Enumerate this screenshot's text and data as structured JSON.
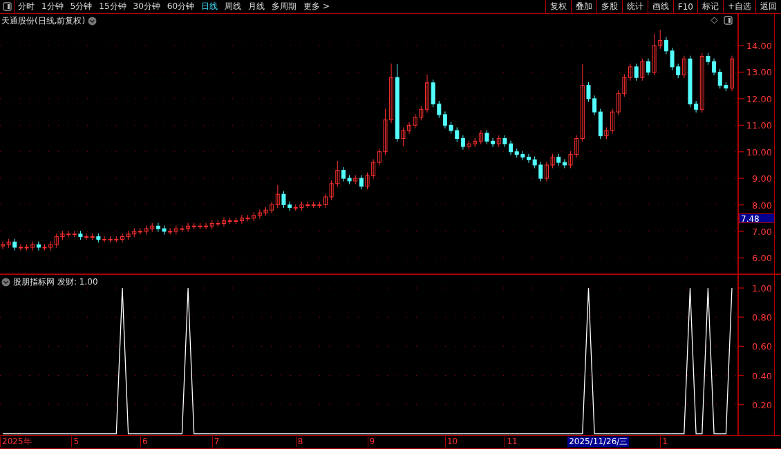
{
  "toolbar": {
    "periods": [
      {
        "label": "分时",
        "selected": false
      },
      {
        "label": "1分钟",
        "selected": false
      },
      {
        "label": "5分钟",
        "selected": false
      },
      {
        "label": "15分钟",
        "selected": false
      },
      {
        "label": "30分钟",
        "selected": false
      },
      {
        "label": "60分钟",
        "selected": false
      },
      {
        "label": "日线",
        "selected": true
      },
      {
        "label": "周线",
        "selected": false
      },
      {
        "label": "月线",
        "selected": false
      },
      {
        "label": "多周期",
        "selected": false
      },
      {
        "label": "更多 >",
        "selected": false
      }
    ],
    "buttons": [
      "复权",
      "叠加",
      "多股",
      "统计",
      "画线",
      "F10",
      "标记",
      "+自选",
      "返回"
    ]
  },
  "price_pane": {
    "title": "天通股份(日线,前复权)",
    "cursor_price": "7.48",
    "chart_data": {
      "type": "candlestick",
      "grid": true,
      "ohlc": [
        [
          6.45,
          6.62,
          6.33,
          6.5
        ],
        [
          6.5,
          6.72,
          6.38,
          6.6
        ],
        [
          6.6,
          6.72,
          6.28,
          6.4
        ],
        [
          6.4,
          6.52,
          6.28,
          6.4
        ],
        [
          6.4,
          6.52,
          6.28,
          6.4
        ],
        [
          6.4,
          6.62,
          6.28,
          6.5
        ],
        [
          6.5,
          6.62,
          6.28,
          6.4
        ],
        [
          6.4,
          6.52,
          6.28,
          6.4
        ],
        [
          6.4,
          6.62,
          6.28,
          6.5
        ],
        [
          6.5,
          6.92,
          6.38,
          6.8
        ],
        [
          6.8,
          7.02,
          6.68,
          6.9
        ],
        [
          6.9,
          7.02,
          6.78,
          6.9
        ],
        [
          6.9,
          7.02,
          6.78,
          6.9
        ],
        [
          6.9,
          7.02,
          6.68,
          6.8
        ],
        [
          6.8,
          6.92,
          6.68,
          6.8
        ],
        [
          6.8,
          6.92,
          6.68,
          6.8
        ],
        [
          6.8,
          6.92,
          6.58,
          6.7
        ],
        [
          6.7,
          6.82,
          6.58,
          6.7
        ],
        [
          6.7,
          6.82,
          6.58,
          6.7
        ],
        [
          6.7,
          6.82,
          6.58,
          6.7
        ],
        [
          6.7,
          6.92,
          6.58,
          6.8
        ],
        [
          6.8,
          7.02,
          6.68,
          6.9
        ],
        [
          6.9,
          7.12,
          6.78,
          7.0
        ],
        [
          7.0,
          7.12,
          6.88,
          7.0
        ],
        [
          7.0,
          7.22,
          6.88,
          7.1
        ],
        [
          7.1,
          7.32,
          6.98,
          7.2
        ],
        [
          7.2,
          7.32,
          6.98,
          7.1
        ],
        [
          7.1,
          7.22,
          6.88,
          7.0
        ],
        [
          7.0,
          7.12,
          6.88,
          7.0
        ],
        [
          7.0,
          7.22,
          6.88,
          7.1
        ],
        [
          7.1,
          7.22,
          6.98,
          7.1
        ],
        [
          7.1,
          7.32,
          6.98,
          7.2
        ],
        [
          7.2,
          7.32,
          7.08,
          7.2
        ],
        [
          7.2,
          7.32,
          7.08,
          7.2
        ],
        [
          7.2,
          7.32,
          7.08,
          7.2
        ],
        [
          7.2,
          7.42,
          7.08,
          7.3
        ],
        [
          7.3,
          7.42,
          7.18,
          7.3
        ],
        [
          7.3,
          7.52,
          7.18,
          7.4
        ],
        [
          7.4,
          7.52,
          7.28,
          7.4
        ],
        [
          7.4,
          7.52,
          7.28,
          7.4
        ],
        [
          7.4,
          7.62,
          7.28,
          7.5
        ],
        [
          7.5,
          7.62,
          7.38,
          7.5
        ],
        [
          7.5,
          7.72,
          7.38,
          7.6
        ],
        [
          7.6,
          7.82,
          7.48,
          7.7
        ],
        [
          7.7,
          7.92,
          7.58,
          7.8
        ],
        [
          7.8,
          8.12,
          7.68,
          8.0
        ],
        [
          8.0,
          8.75,
          7.88,
          8.4
        ],
        [
          8.4,
          8.52,
          7.88,
          8.0
        ],
        [
          8.0,
          8.12,
          7.78,
          7.9
        ],
        [
          7.9,
          8.02,
          7.78,
          7.9
        ],
        [
          7.9,
          8.12,
          7.78,
          8.0
        ],
        [
          8.0,
          8.12,
          7.88,
          8.0
        ],
        [
          8.0,
          8.12,
          7.88,
          8.0
        ],
        [
          8.0,
          8.12,
          7.88,
          8.0
        ],
        [
          8.0,
          8.42,
          7.88,
          8.3
        ],
        [
          8.3,
          8.92,
          8.18,
          8.8
        ],
        [
          8.8,
          9.65,
          8.68,
          9.3
        ],
        [
          9.3,
          9.42,
          8.88,
          9.0
        ],
        [
          9.0,
          9.12,
          8.78,
          8.9
        ],
        [
          8.9,
          9.12,
          8.78,
          9.0
        ],
        [
          9.0,
          9.12,
          8.58,
          8.7
        ],
        [
          8.7,
          9.22,
          8.58,
          9.1
        ],
        [
          9.1,
          9.72,
          8.98,
          9.6
        ],
        [
          9.6,
          10.12,
          9.48,
          10.0
        ],
        [
          10.0,
          11.62,
          9.88,
          11.2
        ],
        [
          11.2,
          13.32,
          11.08,
          12.8
        ],
        [
          12.8,
          13.3,
          10.38,
          10.5
        ],
        [
          10.5,
          10.92,
          10.2,
          10.8
        ],
        [
          10.8,
          11.12,
          10.68,
          11.0
        ],
        [
          11.0,
          11.42,
          10.88,
          11.3
        ],
        [
          11.3,
          11.72,
          11.18,
          11.6
        ],
        [
          11.6,
          12.92,
          11.48,
          12.6
        ],
        [
          12.6,
          12.72,
          11.68,
          11.8
        ],
        [
          11.8,
          11.92,
          11.28,
          11.4
        ],
        [
          11.4,
          11.52,
          10.88,
          11.0
        ],
        [
          11.0,
          11.12,
          10.68,
          10.8
        ],
        [
          10.8,
          10.92,
          10.38,
          10.5
        ],
        [
          10.5,
          10.62,
          10.08,
          10.2
        ],
        [
          10.2,
          10.42,
          10.08,
          10.3
        ],
        [
          10.3,
          10.52,
          10.18,
          10.4
        ],
        [
          10.4,
          10.82,
          10.28,
          10.7
        ],
        [
          10.7,
          10.82,
          10.28,
          10.4
        ],
        [
          10.4,
          10.52,
          10.18,
          10.3
        ],
        [
          10.3,
          10.62,
          10.18,
          10.5
        ],
        [
          10.5,
          10.62,
          10.18,
          10.3
        ],
        [
          10.3,
          10.42,
          9.88,
          10.0
        ],
        [
          10.0,
          10.12,
          9.78,
          9.9
        ],
        [
          9.9,
          10.02,
          9.68,
          9.8
        ],
        [
          9.8,
          9.92,
          9.58,
          9.7
        ],
        [
          9.7,
          9.82,
          9.38,
          9.5
        ],
        [
          9.5,
          9.62,
          8.88,
          9.0
        ],
        [
          9.0,
          9.62,
          8.88,
          9.5
        ],
        [
          9.5,
          9.92,
          9.38,
          9.8
        ],
        [
          9.8,
          9.92,
          9.48,
          9.6
        ],
        [
          9.6,
          9.72,
          9.38,
          9.5
        ],
        [
          9.5,
          10.02,
          9.38,
          9.9
        ],
        [
          9.9,
          10.62,
          9.78,
          10.5
        ],
        [
          10.5,
          13.3,
          10.38,
          12.5
        ],
        [
          12.5,
          12.62,
          11.88,
          12.0
        ],
        [
          12.0,
          12.12,
          11.38,
          11.5
        ],
        [
          11.5,
          11.62,
          10.48,
          10.6
        ],
        [
          10.6,
          10.92,
          10.48,
          10.8
        ],
        [
          10.8,
          11.62,
          10.68,
          11.5
        ],
        [
          11.5,
          12.32,
          11.38,
          12.2
        ],
        [
          12.2,
          12.92,
          12.08,
          12.8
        ],
        [
          12.8,
          13.32,
          12.68,
          13.2
        ],
        [
          13.2,
          13.32,
          12.68,
          12.8
        ],
        [
          12.8,
          13.52,
          12.68,
          13.4
        ],
        [
          13.4,
          13.52,
          12.88,
          13.0
        ],
        [
          13.0,
          14.45,
          12.88,
          14.0
        ],
        [
          14.0,
          14.6,
          13.88,
          14.2
        ],
        [
          14.2,
          14.32,
          13.68,
          13.8
        ],
        [
          13.8,
          13.92,
          13.08,
          13.2
        ],
        [
          13.2,
          13.32,
          12.78,
          12.9
        ],
        [
          12.9,
          13.62,
          12.78,
          13.5
        ],
        [
          13.5,
          13.62,
          11.68,
          11.8
        ],
        [
          11.8,
          11.92,
          11.48,
          11.6
        ],
        [
          11.6,
          13.72,
          11.48,
          13.6
        ],
        [
          13.6,
          13.72,
          13.28,
          13.4
        ],
        [
          13.4,
          13.52,
          12.88,
          13.0
        ],
        [
          13.0,
          13.12,
          12.38,
          12.5
        ],
        [
          12.5,
          12.62,
          12.28,
          12.4
        ],
        [
          12.4,
          13.62,
          12.28,
          13.5
        ]
      ],
      "ylim": [
        5.41,
        15.2
      ],
      "yticks": [
        {
          "value": 6,
          "label": "6.00"
        },
        {
          "value": 7,
          "label": "7.00"
        },
        {
          "value": 8,
          "label": "8.00"
        },
        {
          "value": 9,
          "label": "9.00"
        },
        {
          "value": 10,
          "label": "10.00"
        },
        {
          "value": 11,
          "label": "11.00"
        },
        {
          "value": 12,
          "label": "12.00"
        },
        {
          "value": 13,
          "label": "13.00"
        },
        {
          "value": 14,
          "label": "14.00"
        }
      ]
    }
  },
  "indicator_pane": {
    "name": "股朋指标网",
    "reading": "发财: 1.00",
    "chart_data": {
      "type": "line",
      "grid": true,
      "values": [
        0,
        0,
        0,
        0,
        0,
        0,
        0,
        0,
        0,
        0,
        0,
        0,
        0,
        0,
        0,
        0,
        0,
        0,
        0,
        0,
        1,
        0,
        0,
        0,
        0,
        0,
        0,
        0,
        0,
        0,
        0,
        1,
        0,
        0,
        0,
        0,
        0,
        0,
        0,
        0,
        0,
        0,
        0,
        0,
        0,
        0,
        0,
        0,
        0,
        0,
        0,
        0,
        0,
        0,
        0,
        0,
        0,
        0,
        0,
        0,
        0,
        0,
        0,
        0,
        0,
        0,
        0,
        0,
        0,
        0,
        0,
        0,
        0,
        0,
        0,
        0,
        0,
        0,
        0,
        0,
        0,
        0,
        0,
        0,
        0,
        0,
        0,
        0,
        0,
        0,
        0,
        0,
        0,
        0,
        0,
        0,
        0,
        0,
        1,
        0,
        0,
        0,
        0,
        0,
        0,
        0,
        0,
        0,
        0,
        0,
        0,
        0,
        0,
        0,
        0,
        1,
        0,
        0,
        1,
        0,
        0,
        0,
        1
      ],
      "ylim": [
        -0.01,
        1.09
      ],
      "yticks": [
        {
          "value": 0.2,
          "label": "0.20"
        },
        {
          "value": 0.4,
          "label": "0.40"
        },
        {
          "value": 0.6,
          "label": "0.60"
        },
        {
          "value": 0.8,
          "label": "0.80"
        },
        {
          "value": 1,
          "label": "1.00"
        }
      ]
    }
  },
  "time_axis": {
    "labels": [
      "2025年",
      "5",
      "6",
      "7",
      "8",
      "9",
      "10",
      "11",
      "1"
    ],
    "cursor_label": "2025/11/26/三"
  }
}
